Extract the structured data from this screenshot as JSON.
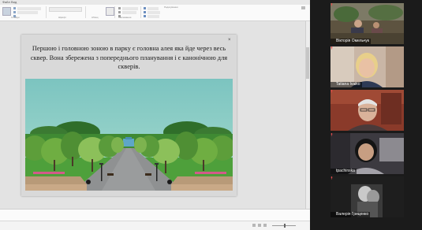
{
  "app": {
    "titlebar_left": "Файл",
    "titlebar_right": "Вид"
  },
  "ribbon": {
    "group_slides": "Слайди",
    "group_font": "Шрифт",
    "group_paragraph": "Абзац",
    "group_drawing": "Малювання",
    "group_edit": "Редагування"
  },
  "slide": {
    "text": "Першою і головною зоною в парку є головна алея яка йде через весь сквер. Вона збережена з попереднього планування і є канонічною для скверів.",
    "close_symbol": "×"
  },
  "participants": [
    {
      "name": "Вікторія Омельчук",
      "active": false
    },
    {
      "name": "Tatiana Ivaiko",
      "active": false
    },
    {
      "name": "",
      "active": false
    },
    {
      "name": "tpachinska",
      "active": false
    },
    {
      "name": "Валерія Гриценко",
      "active": true
    }
  ],
  "colors": {
    "active_speaker": "#d4e35a",
    "sky": "#7fc7c4",
    "lawn": "#4ea03b",
    "path": "#8f9192",
    "slide_bg": "#d9d9d9"
  }
}
